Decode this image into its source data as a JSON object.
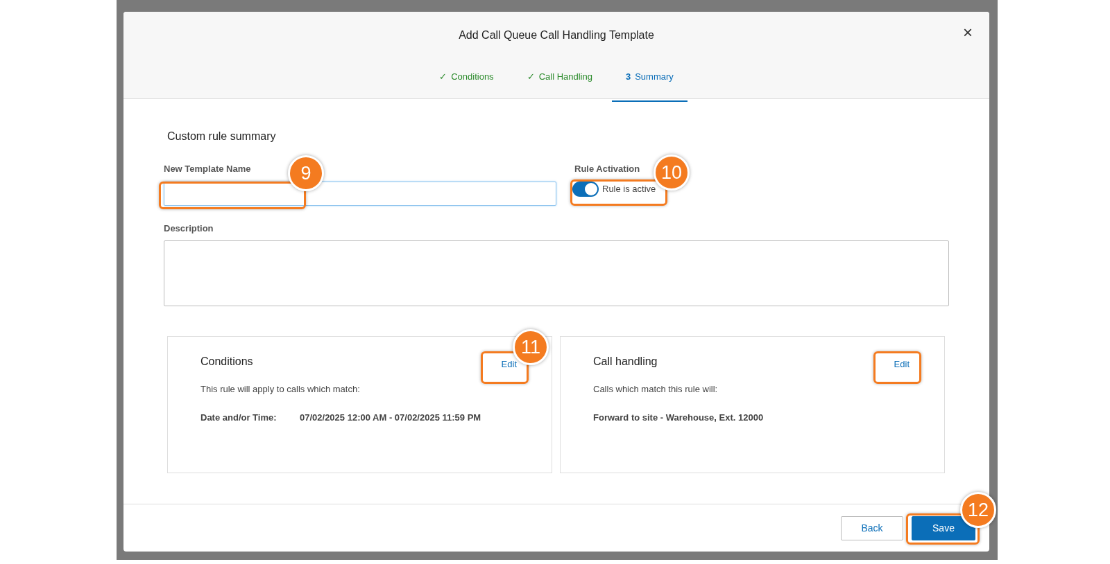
{
  "dialog": {
    "title": "Add Call Queue Call Handling Template",
    "close": "×"
  },
  "steps": [
    {
      "label": "Conditions",
      "marker": "✓",
      "completed": true,
      "selected": false
    },
    {
      "label": "Call Handling",
      "marker": "✓",
      "completed": true,
      "selected": false
    },
    {
      "label": "Summary",
      "marker": "3",
      "completed": false,
      "selected": true
    }
  ],
  "heading": "Custom rule summary",
  "template_name": {
    "label": "New Template Name"
  },
  "rule_activation": {
    "label": "Rule Activation",
    "toggle_label": "Rule is active",
    "on": true
  },
  "description": {
    "label": "Description"
  },
  "cards": [
    {
      "title": "Conditions",
      "edit": "Edit",
      "intro": "This rule will apply to calls which match:",
      "detail_label": "Date and/or Time:",
      "detail_value": "07/02/2025 12:00 AM - 07/02/2025 11:59 PM"
    },
    {
      "title": "Call handling",
      "edit": "Edit",
      "intro": "Calls which match this rule will:",
      "detail_value": "Forward to site - Warehouse, Ext. 12000"
    }
  ],
  "buttons": [
    {
      "label": "Back",
      "kind": "secondary"
    },
    {
      "label": "Save",
      "kind": "primary"
    }
  ],
  "callouts": [
    "9",
    "10",
    "11",
    "12"
  ]
}
